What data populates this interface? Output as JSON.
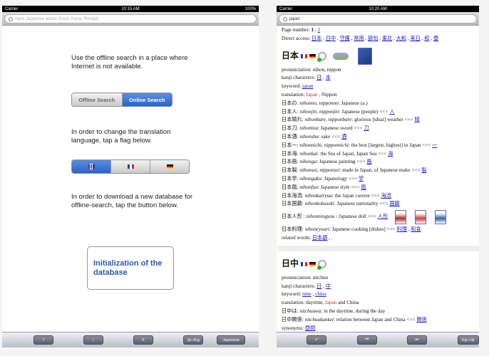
{
  "left": {
    "status": {
      "carrier": "Carrier",
      "time": "10:15 AM",
      "battery": "100%"
    },
    "search": {
      "placeholder": "Input Japanese words (Kanji, Kana, Romaji)",
      "value": ""
    },
    "msg1": "Use the offline search in a place where Internet is not available.",
    "search_mode": {
      "options": [
        "Offline Search",
        "Online Search"
      ],
      "selected": "Online Search"
    },
    "msg2": "In order to change the translation language, tap a flag below.",
    "flags": [
      "uk-flag",
      "fr-flag",
      "de-flag"
    ],
    "selected_flag": "uk-flag",
    "msg3": "In order to download a new database for offline-search, tap the button below.",
    "init_button": "Initialization of the database",
    "toolbar": {
      "help": "?",
      "info": "i",
      "font": "iT",
      "direction": "Jp->Eg",
      "language": "Japanese"
    }
  },
  "right": {
    "status": {
      "carrier": "Carrier",
      "time": "10:20 AM"
    },
    "search": {
      "value": "japan"
    },
    "page_label": "Page number:",
    "page_current": "1",
    "page_sep": " , ",
    "page_other": "2",
    "direct_label": "Direct access:",
    "direct_links": [
      "日本",
      "日中",
      "守護",
      "常用",
      "節句",
      "東北",
      "大和",
      "来日",
      "和",
      "倭"
    ],
    "entry1": {
      "word": "日本",
      "pronunciation": "pronunciation: nihon, nippon",
      "kanji_label": "kanji characters:",
      "kanji": [
        "日",
        "本"
      ],
      "keyword_label": "keyword:",
      "keywords": [
        "japan"
      ],
      "translation_label": "translation:",
      "translation_hl": "Japan",
      "translation_rest": ", Nippon",
      "compounds": [
        {
          "k": "日本の",
          "r": "nihonno, nipponno",
          "m": "Japanese (a.)",
          "l": ""
        },
        {
          "k": "日本人",
          "r": "nihonjin, nipponjin",
          "m": "Japanese (people) <<<",
          "l": "人"
        },
        {
          "k": "日本晴れ",
          "r": "nihonbare, nipponbare",
          "m": "glorious [ideal] weather <<<",
          "l": "晴"
        },
        {
          "k": "日本刀",
          "r": "nihontou",
          "m": "Japanese sword <<<",
          "l": "刀"
        },
        {
          "k": "日本酒",
          "r": "nihonshu",
          "m": "sake <<<",
          "l": "酒"
        },
        {
          "k": "日本一",
          "r": "nihonnichi, nipponnichi",
          "m": "the best [largest, highest] in Japan <<<",
          "l": "一"
        },
        {
          "k": "日本海",
          "r": "nihonkai",
          "m": "the Sea of Japan, Japan Sea <<<",
          "l": "海"
        },
        {
          "k": "日本画",
          "r": "nihonga",
          "m": "Japanese painting <<<",
          "l": "画"
        },
        {
          "k": "日本製",
          "r": "nihonsei, nipponsei",
          "m": "made in Japan, of Japanese make <<<",
          "l": "製"
        },
        {
          "k": "日本学",
          "r": "nihongaku",
          "m": "Japanology <<<",
          "l": "学"
        },
        {
          "k": "日本風",
          "r": "nihonfuu",
          "m": "Japanese style <<<",
          "l": "風"
        },
        {
          "k": "日本海流",
          "r": "nihonkairyuu",
          "m": "the Japan current <<<",
          "l": "海流"
        },
        {
          "k": "日本国籍",
          "r": "nihonkokuseki",
          "m": "Japanese nationality <<<",
          "l": "国籍"
        },
        {
          "k": "日本人形",
          "r": "nihonningyou",
          "m": "Japanese doll <<<",
          "l": "人形"
        },
        {
          "k": "日本料理",
          "r": "nihonryouri",
          "m": "Japanese cooking [dishes] <<<",
          "l": "料理",
          "l2": "和食"
        }
      ],
      "related_label": "related words:",
      "related": [
        "日本語"
      ],
      "related_tail": " , ."
    },
    "entry2": {
      "word": "日中",
      "pronunciation": "pronunciation: nitchuu",
      "kanji_label": "kanji characters:",
      "kanji": [
        "日",
        "中"
      ],
      "keyword_label": "keyword:",
      "keywords": [
        "time",
        "china"
      ],
      "translation_label": "translation: daytime,",
      "translation_hl": "Japan",
      "translation_rest": "and China",
      "compounds": [
        {
          "k": "日中は",
          "r": "nitchuuwa",
          "m": "in the daytime, during the day",
          "l": ""
        },
        {
          "k": "日中関係",
          "r": "nitchuukankei",
          "m": "relation between Japan and China <<<",
          "l": "関係"
        }
      ],
      "synonyms_label": "synonyms:",
      "synonyms": [
        "昼間"
      ]
    },
    "toolbar": {
      "back": "↶",
      "prev": "⏮",
      "next": "⏭",
      "direction": "Eg->Jp"
    }
  }
}
